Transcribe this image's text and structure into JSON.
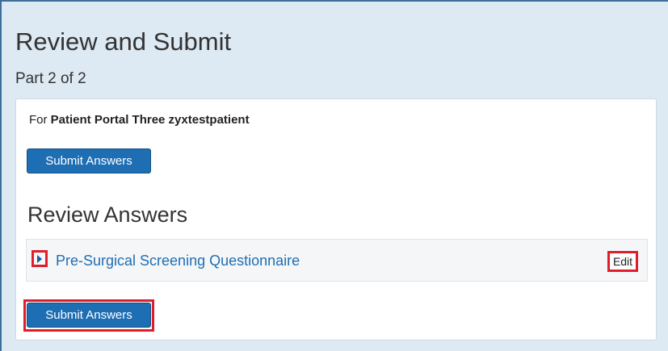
{
  "header": {
    "title": "Review and Submit",
    "subtitle": "Part 2 of 2"
  },
  "card": {
    "for_prefix": "For",
    "patient_name": "Patient Portal Three zyxtestpatient",
    "submit_top_label": "Submit Answers",
    "review_title": "Review Answers",
    "questionnaire": {
      "toggle_icon": "caret-right-icon",
      "title": "Pre-Surgical Screening Questionnaire",
      "edit_label": "Edit"
    },
    "submit_bottom_label": "Submit Answers"
  },
  "colors": {
    "background": "#dde9f3",
    "primary_button": "#1e6eb4",
    "link": "#1e6eb4",
    "highlight": "#e01e2b"
  }
}
